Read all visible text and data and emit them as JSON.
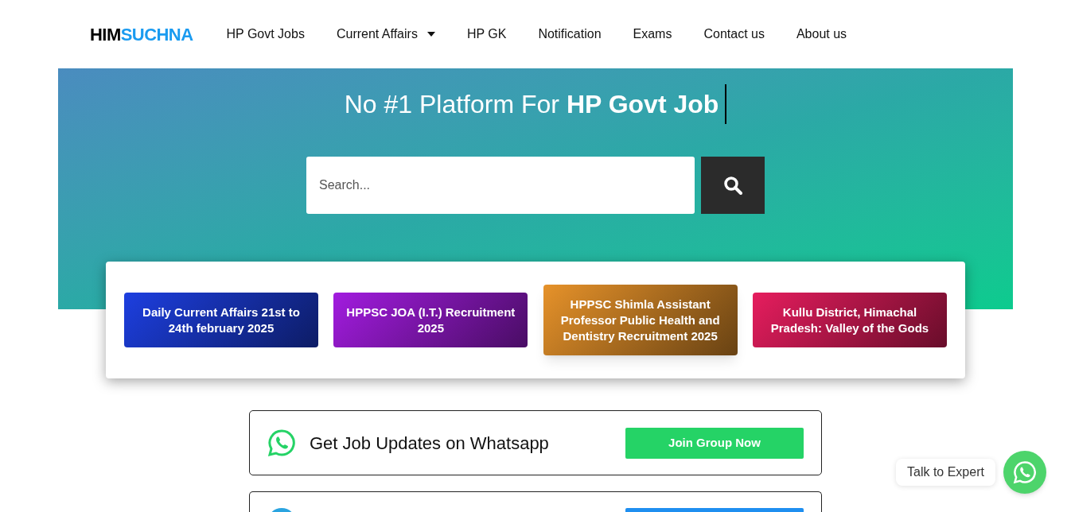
{
  "logo": {
    "part_1": "HIM",
    "part_2": "SUCHNA"
  },
  "nav": [
    {
      "label": "HP Govt Jobs",
      "dropdown": false
    },
    {
      "label": "Current Affairs",
      "dropdown": true
    },
    {
      "label": "HP GK",
      "dropdown": false
    },
    {
      "label": "Notification",
      "dropdown": false
    },
    {
      "label": "Exams",
      "dropdown": false
    },
    {
      "label": "Contact us",
      "dropdown": false
    },
    {
      "label": "About us",
      "dropdown": false
    }
  ],
  "hero": {
    "title": "No #1 Platform For **HP Govt Job**",
    "search": {
      "placeholder": "Search..."
    }
  },
  "posts": [
    {
      "title": "Daily Current Affairs 21st  to 24th february 2025",
      "color": "#1d3fe0",
      "hovered": false
    },
    {
      "title": "HPPSC JOA (I.T.) Recruitment 2025",
      "color": "#a21cdf",
      "hovered": false
    },
    {
      "title": "HPPSC Shimla Assistant Professor Public Health and Dentistry Recruitment 2025",
      "color": "#e6922a",
      "hovered": true
    },
    {
      "title": "Kullu District, Himachal Pradesh: Valley of the Gods",
      "color": "#e61d5e",
      "hovered": false
    }
  ],
  "whatsapp_box": {
    "text": "Get Job Updates on Whatsapp",
    "button": "Join Group Now"
  },
  "chat_widget": {
    "label": "Talk to Expert"
  }
}
